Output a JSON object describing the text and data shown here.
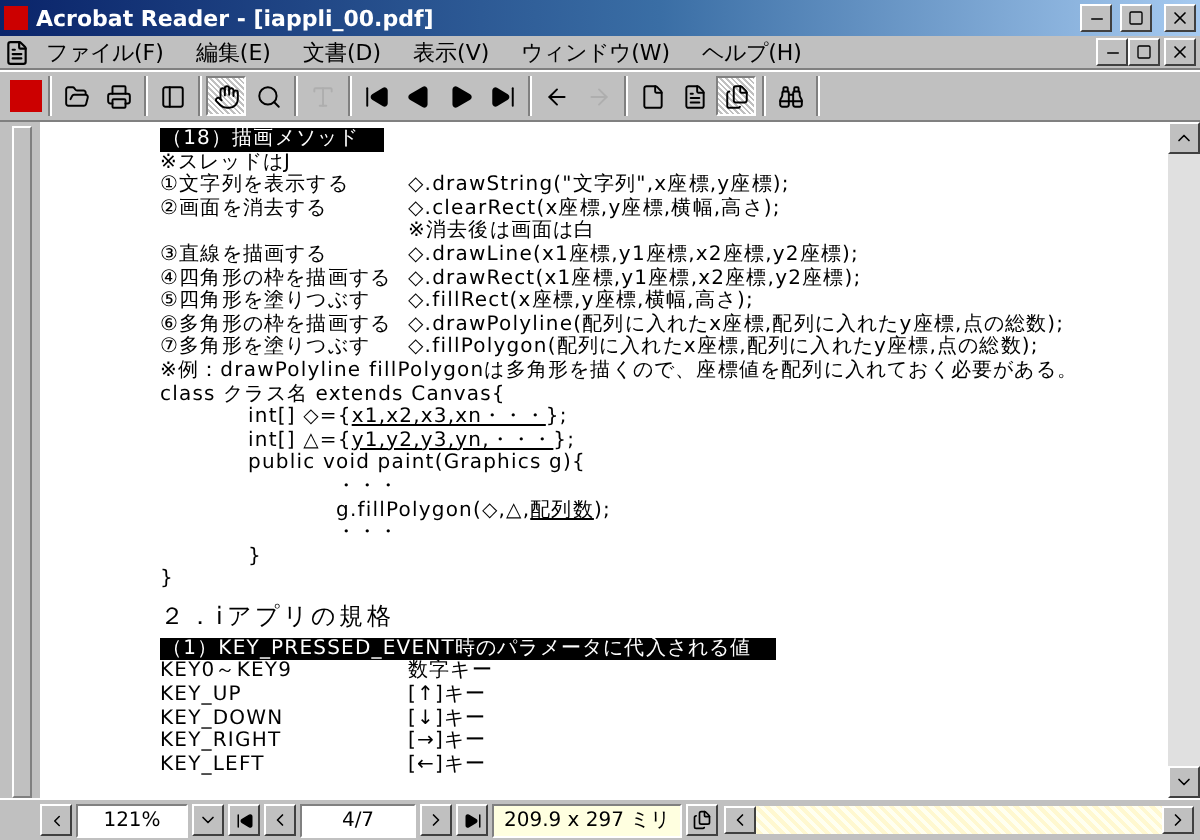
{
  "window": {
    "title": "Acrobat Reader - [iappli_00.pdf]"
  },
  "menu": [
    {
      "label": "ファイル(F)"
    },
    {
      "label": "編集(E)"
    },
    {
      "label": "文書(D)"
    },
    {
      "label": "表示(V)"
    },
    {
      "label": "ウィンドウ(W)"
    },
    {
      "label": "ヘルプ(H)"
    }
  ],
  "toolbar": [
    [
      {
        "kind": "open",
        "selected": false,
        "disabled": false
      },
      {
        "kind": "print",
        "selected": false,
        "disabled": false
      }
    ],
    [
      {
        "kind": "panel",
        "selected": false,
        "disabled": false
      }
    ],
    [
      {
        "kind": "hand",
        "selected": true,
        "disabled": false
      },
      {
        "kind": "zoom",
        "selected": false,
        "disabled": false
      }
    ],
    [
      {
        "kind": "text",
        "selected": false,
        "disabled": true
      }
    ],
    [
      {
        "kind": "first",
        "selected": false,
        "disabled": false
      },
      {
        "kind": "prev",
        "selected": false,
        "disabled": false
      },
      {
        "kind": "next",
        "selected": false,
        "disabled": false
      },
      {
        "kind": "last",
        "selected": false,
        "disabled": false
      }
    ],
    [
      {
        "kind": "back",
        "selected": false,
        "disabled": false
      },
      {
        "kind": "forward",
        "selected": false,
        "disabled": true
      }
    ],
    [
      {
        "kind": "actual",
        "selected": false,
        "disabled": false
      },
      {
        "kind": "fitpage",
        "selected": false,
        "disabled": false
      },
      {
        "kind": "fitwidth",
        "selected": true,
        "disabled": false
      }
    ],
    [
      {
        "kind": "find",
        "selected": false,
        "disabled": false
      }
    ]
  ],
  "document": [
    {
      "kind": "bar",
      "text": "（18）描画メソッド"
    },
    {
      "kind": "line",
      "text": "※スレッドはJ"
    },
    {
      "kind": "pair",
      "left": "①文字列を表示する",
      "right": "◇.drawString(\"文字列\",x座標,y座標);"
    },
    {
      "kind": "pair",
      "left": "②画面を消去する",
      "right": "◇.clearRect(x座標,y座標,横幅,高さ);"
    },
    {
      "kind": "pair",
      "right": "※消去後は画面は白"
    },
    {
      "kind": "pair",
      "left": "③直線を描画する",
      "right": "◇.drawLine(x1座標,y1座標,x2座標,y2座標);"
    },
    {
      "kind": "pair",
      "left": "④四角形の枠を描画する",
      "right": "◇.drawRect(x1座標,y1座標,x2座標,y2座標);"
    },
    {
      "kind": "pair",
      "left": "⑤四角形を塗りつぶす",
      "right": "◇.fillRect(x座標,y座標,横幅,高さ);"
    },
    {
      "kind": "pair",
      "left": "⑥多角形の枠を描画する",
      "right": "◇.drawPolyline(配列に入れたx座標,配列に入れたy座標,点の総数);"
    },
    {
      "kind": "pair",
      "left": "⑦多角形を塗りつぶす",
      "right": "◇.fillPolygon(配列に入れたx座標,配列に入れたy座標,点の総数);"
    },
    {
      "kind": "line",
      "text": "※例：drawPolyline fillPolygonは多角形を描くので、座標値を配列に入れておく必要がある。"
    },
    {
      "kind": "code",
      "lines": [
        {
          "before": "class クラス名  extends Canvas{",
          "children": [
            {
              "before": "int[]  ◇={",
              "underlined": "x1,x2,x3,xn・・・",
              "after": "};"
            },
            {
              "before": "int[]  △={",
              "underlined": "y1,y2,y3,yn,・・・",
              "after": "};"
            },
            {
              "before": "public void paint(Graphics g){",
              "children": [
                {
                  "before": "・・・"
                },
                {
                  "before": "g.fillPolygon(◇,△,",
                  "underlined": "配列数",
                  "after": ");"
                },
                {
                  "before": "・・・"
                }
              ]
            },
            {
              "before": "}"
            }
          ]
        },
        {
          "before": "}"
        }
      ]
    },
    {
      "kind": "title",
      "text": "２．iアプリの規格"
    },
    {
      "kind": "bar",
      "text": "（1）KEY_PRESSED_EVENT時のパラメータに代入される値"
    },
    {
      "kind": "pair",
      "left": "KEY0～KEY9",
      "right": "数字キー"
    },
    {
      "kind": "pair",
      "left": "KEY_UP",
      "right": "[↑]キー"
    },
    {
      "kind": "pair",
      "left": "KEY_DOWN",
      "right": "[↓]キー"
    },
    {
      "kind": "pair",
      "left": "KEY_RIGHT",
      "right": "[→]キー"
    },
    {
      "kind": "pair",
      "left": "KEY_LEFT",
      "right": "[←]キー"
    }
  ],
  "status_bar": {
    "zoom": "121%",
    "page": "4/7",
    "page_size": "209.9 x 297 ミリ"
  }
}
